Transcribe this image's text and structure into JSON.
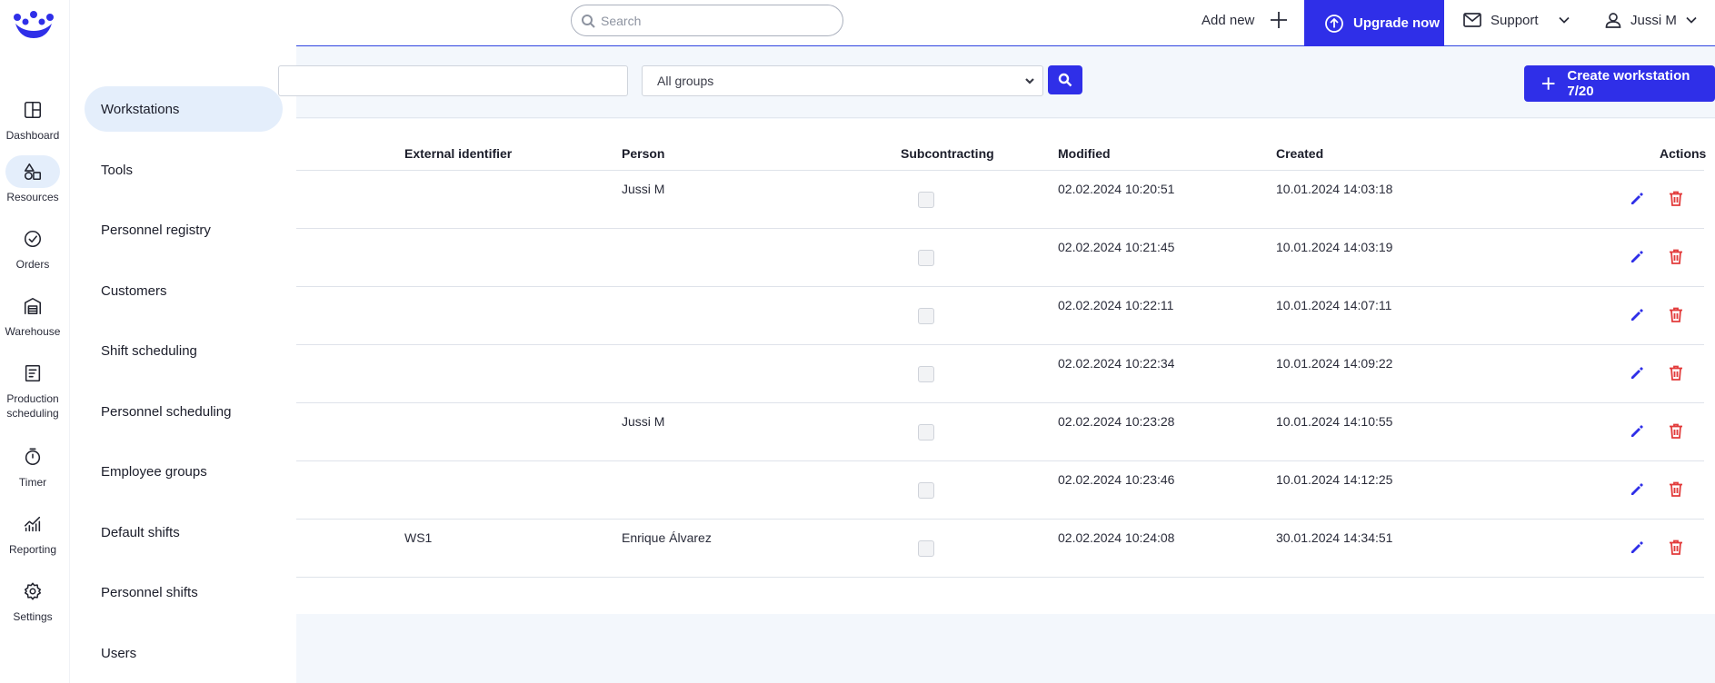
{
  "rail": {
    "items": [
      {
        "label": "Dashboard",
        "icon": "dashboard-icon"
      },
      {
        "label": "Resources",
        "icon": "resources-icon"
      },
      {
        "label": "Orders",
        "icon": "orders-icon"
      },
      {
        "label": "Warehouse",
        "icon": "warehouse-icon"
      },
      {
        "label": "Production scheduling",
        "icon": "production-scheduling-icon"
      },
      {
        "label": "Timer",
        "icon": "timer-icon"
      },
      {
        "label": "Reporting",
        "icon": "reporting-icon"
      },
      {
        "label": "Settings",
        "icon": "settings-icon"
      }
    ],
    "active": "Resources"
  },
  "submenu": {
    "items": [
      "Workstations",
      "Tools",
      "Personnel registry",
      "Customers",
      "Shift scheduling",
      "Personnel scheduling",
      "Employee groups",
      "Default shifts",
      "Personnel shifts",
      "Users"
    ],
    "active": "Workstations"
  },
  "topbar": {
    "search_placeholder": "Search",
    "add_new_label": "Add new",
    "upgrade_label": "Upgrade now",
    "support_label": "Support",
    "user_label": "Jussi M"
  },
  "filters": {
    "name_value": "",
    "group_selected": "All groups",
    "create_label": "Create workstation 7/20"
  },
  "table": {
    "columns": [
      "External identifier",
      "Person",
      "Subcontracting",
      "Modified",
      "Created",
      "Actions"
    ],
    "rows": [
      {
        "external_id": "",
        "person": "Jussi M",
        "subcontracting": false,
        "modified": "02.02.2024 10:20:51",
        "created": "10.01.2024 14:03:18"
      },
      {
        "external_id": "",
        "person": "",
        "subcontracting": false,
        "modified": "02.02.2024 10:21:45",
        "created": "10.01.2024 14:03:19"
      },
      {
        "external_id": "",
        "person": "",
        "subcontracting": false,
        "modified": "02.02.2024 10:22:11",
        "created": "10.01.2024 14:07:11"
      },
      {
        "external_id": "",
        "person": "",
        "subcontracting": false,
        "modified": "02.02.2024 10:22:34",
        "created": "10.01.2024 14:09:22"
      },
      {
        "external_id": "",
        "person": "Jussi M",
        "subcontracting": false,
        "modified": "02.02.2024 10:23:28",
        "created": "10.01.2024 14:10:55"
      },
      {
        "external_id": "",
        "person": "",
        "subcontracting": false,
        "modified": "02.02.2024 10:23:46",
        "created": "10.01.2024 14:12:25"
      },
      {
        "external_id": "WS1",
        "person": "Enrique Álvarez",
        "subcontracting": false,
        "modified": "02.02.2024 10:24:08",
        "created": "30.01.2024 14:34:51"
      }
    ]
  },
  "colors": {
    "accent": "#2f2fe8",
    "delete": "#e23b3b",
    "active_bg": "#e4eefb"
  }
}
